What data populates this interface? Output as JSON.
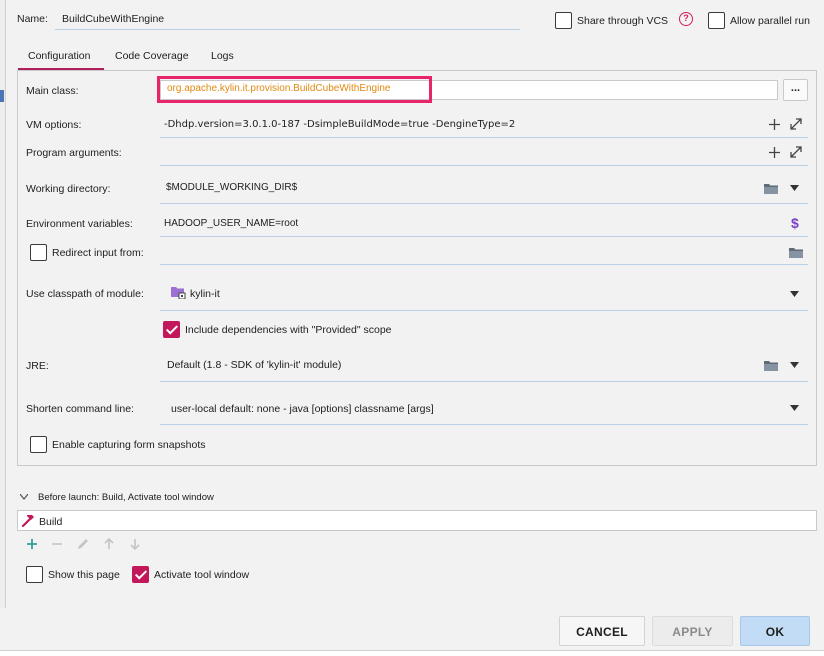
{
  "header": {
    "name_label": "Name:",
    "name_value": "BuildCubeWithEngine",
    "share_label": "Share through VCS",
    "allow_parallel_label": "Allow parallel run"
  },
  "tabs": [
    {
      "label": "Configuration",
      "active": true
    },
    {
      "label": "Code Coverage",
      "active": false
    },
    {
      "label": "Logs",
      "active": false
    }
  ],
  "form": {
    "main_class_label": "Main class:",
    "main_class_value": "org.apache.kylin.it.provision.BuildCubeWithEngine",
    "browse_label": "...",
    "vm_options_label": "VM options:",
    "vm_options_value": "-Dhdp.version=3.0.1.0-187 -DsimpleBuildMode=true -DengineType=2",
    "program_args_label": "Program arguments:",
    "program_args_value": "",
    "working_dir_label": "Working directory:",
    "working_dir_value": "$MODULE_WORKING_DIR$",
    "env_label": "Environment variables:",
    "env_value": "HADOOP_USER_NAME=root",
    "env_icon_glyph": "$",
    "redirect_label": "Redirect input from:",
    "classpath_label": "Use classpath of module:",
    "classpath_value": "kylin-it",
    "include_deps_label": "Include dependencies with \"Provided\" scope",
    "jre_label": "JRE:",
    "jre_value": "Default (1.8 - SDK of 'kylin-it' module)",
    "shorten_label": "Shorten command line:",
    "shorten_value": "user-local default: none - java [options] classname [args]",
    "snapshots_label": "Enable capturing form snapshots"
  },
  "before_launch": {
    "title": "Before launch: Build, Activate tool window",
    "items": [
      "Build"
    ],
    "show_page_label": "Show this page",
    "activate_label": "Activate tool window"
  },
  "buttons": {
    "cancel": "CANCEL",
    "apply": "APPLY",
    "ok": "OK"
  },
  "colors": {
    "accent": "#c2185b",
    "highlight_box": "#e8246b",
    "main_class_text": "#e08a12",
    "tab_underline": "#b01f5c",
    "ok_bg": "#c2dcf5",
    "link_purple": "#7b3fc4"
  }
}
